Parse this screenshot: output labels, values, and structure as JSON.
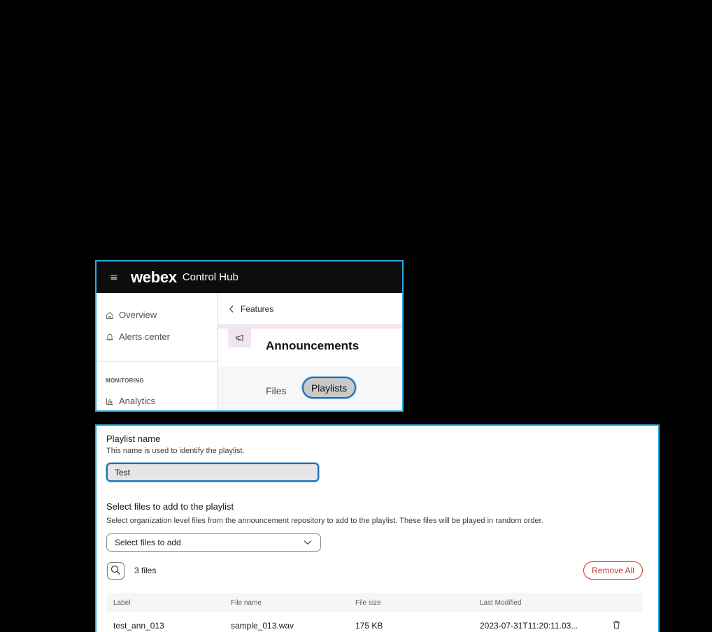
{
  "header": {
    "menu_icon": "hamburger-icon",
    "brand": "webex",
    "product": "Control Hub"
  },
  "sidebar": {
    "items": [
      {
        "label": "Overview",
        "icon": "home-icon"
      },
      {
        "label": "Alerts center",
        "icon": "bell-icon"
      }
    ],
    "section": "MONITORING",
    "section_items": [
      {
        "label": "Analytics",
        "icon": "analytics-icon"
      }
    ]
  },
  "main": {
    "back_label": "Features",
    "title": "Announcements",
    "title_icon": "megaphone-icon",
    "tabs": [
      {
        "label": "Files",
        "selected": false
      },
      {
        "label": "Playlists",
        "selected": true
      }
    ]
  },
  "playlist_form": {
    "name_title": "Playlist name",
    "name_help": "This name is used to identify the playlist.",
    "name_value": "Test",
    "files_title": "Select files to add to the playlist",
    "files_help": "Select organization level files from the announcement repository to add to the playlist. These files will be played in random order.",
    "files_placeholder": "Select files to add",
    "file_count": "3 files",
    "remove_all_label": "Remove All",
    "colors": {
      "accent": "#1f6fb4",
      "danger": "#c5342b",
      "panel_border": "#29a8e0"
    }
  },
  "table": {
    "columns": [
      "Label",
      "File name",
      "File size",
      "Last Modified"
    ],
    "rows": [
      {
        "label": "test_ann_013",
        "file_name": "sample_013.wav",
        "file_size": "175 KB",
        "last_modified": "2023-07-31T11:20:11.03..."
      }
    ]
  }
}
